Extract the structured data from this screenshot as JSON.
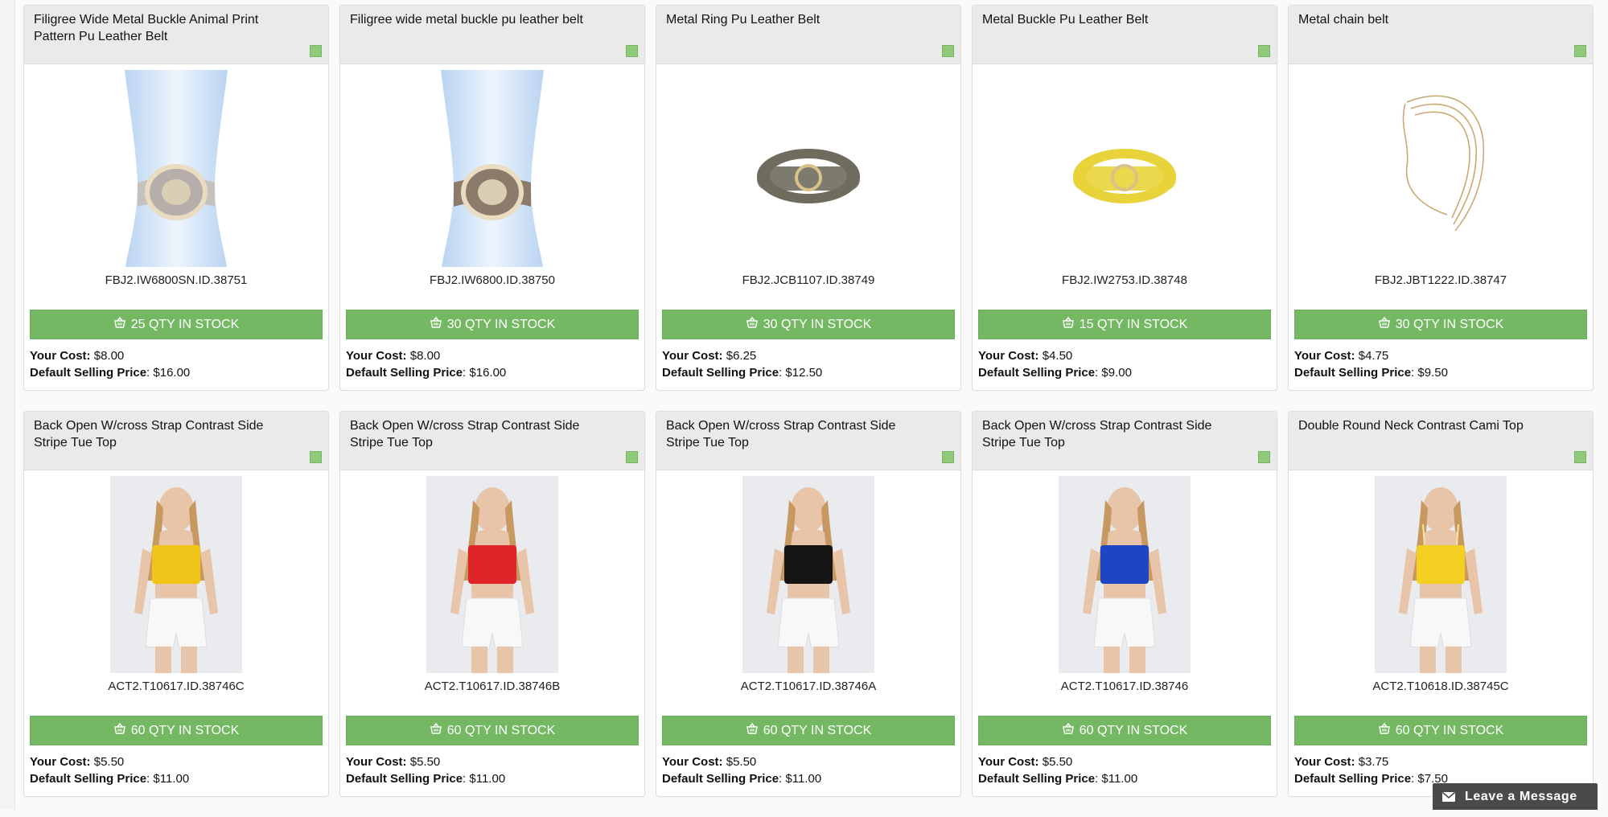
{
  "products_row1": [
    {
      "title": "Filigree Wide Metal Buckle Animal Print Pattern Pu Leather Belt",
      "sku": "FBJ2.IW6800SN.ID.38751",
      "stock": "25 QTY IN STOCK",
      "cost": "$8.00",
      "price": "$16.00",
      "image": "belt-on-mannequin",
      "band_color": "#b7adaa",
      "strap_color": "#c5c1bd"
    },
    {
      "title": "Filigree wide metal buckle pu leather belt",
      "sku": "FBJ2.IW6800.ID.38750",
      "stock": "30 QTY IN STOCK",
      "cost": "$8.00",
      "price": "$16.00",
      "image": "belt-on-mannequin",
      "band_color": "#8c7b6b",
      "strap_color": "#8c7b6b"
    },
    {
      "title": "Metal Ring Pu Leather Belt",
      "sku": "FBJ2.JCB1107.ID.38749",
      "stock": "30 QTY IN STOCK",
      "cost": "$6.25",
      "price": "$12.50",
      "image": "coiled-belt",
      "band_color": "#6f6c5e",
      "strap_color": "#6f6c5e"
    },
    {
      "title": "Metal Buckle Pu Leather Belt",
      "sku": "FBJ2.IW2753.ID.38748",
      "stock": "15 QTY IN STOCK",
      "cost": "$4.50",
      "price": "$9.00",
      "image": "coiled-belt",
      "band_color": "#e8d43a",
      "strap_color": "#e8d43a"
    },
    {
      "title": "Metal chain belt",
      "sku": "FBJ2.JBT1222.ID.38747",
      "stock": "30 QTY IN STOCK",
      "cost": "$4.75",
      "price": "$9.50",
      "image": "chain-belt",
      "band_color": "#c9aa74",
      "strap_color": "#c9aa74"
    }
  ],
  "products_row2": [
    {
      "title": "Back Open W/cross Strap Contrast Side Stripe Tue Top",
      "sku": "ACT2.T10617.ID.38746C",
      "stock": "60 QTY IN STOCK",
      "cost": "$5.50",
      "price": "$11.00",
      "image": "model-tube-top",
      "top_color": "#f0c419"
    },
    {
      "title": "Back Open W/cross Strap Contrast Side Stripe Tue Top",
      "sku": "ACT2.T10617.ID.38746B",
      "stock": "60 QTY IN STOCK",
      "cost": "$5.50",
      "price": "$11.00",
      "image": "model-tube-top",
      "top_color": "#e0252a"
    },
    {
      "title": "Back Open W/cross Strap Contrast Side Stripe Tue Top",
      "sku": "ACT2.T10617.ID.38746A",
      "stock": "60 QTY IN STOCK",
      "cost": "$5.50",
      "price": "$11.00",
      "image": "model-tube-top",
      "top_color": "#151515"
    },
    {
      "title": "Back Open W/cross Strap Contrast Side Stripe Tue Top",
      "sku": "ACT2.T10617.ID.38746",
      "stock": "60 QTY IN STOCK",
      "cost": "$5.50",
      "price": "$11.00",
      "image": "model-tube-top",
      "top_color": "#1c46c2"
    },
    {
      "title": "Double Round Neck Contrast Cami Top",
      "sku": "ACT2.T10618.ID.38745C",
      "stock": "60 QTY IN STOCK",
      "cost": "$3.75",
      "price": "$7.50",
      "image": "model-cami-top",
      "top_color": "#f3cf22"
    }
  ],
  "labels": {
    "your_cost": "Your Cost:",
    "default_selling_price": "Default Selling Price"
  },
  "chat": {
    "label": "Leave a Message",
    "icon": "envelope-icon"
  },
  "colors": {
    "accent_green": "#74b863",
    "header_gray": "#eaeaea",
    "checkbox_green": "#8fca7a"
  }
}
